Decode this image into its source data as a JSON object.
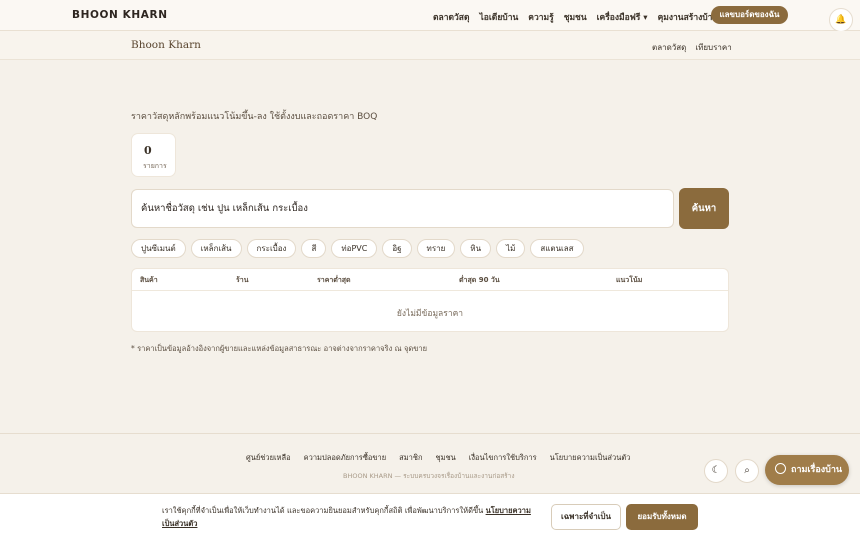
{
  "header": {
    "brand": "BHOON KHARN",
    "nav": [
      "ตลาดวัสดุ",
      "ไอเดียบ้าน",
      "ความรู้",
      "ชุมชน",
      "เครื่องมือฟรี ▾",
      "คุมงานสร้างบ้าน"
    ],
    "cta": "แลขบอร์ดของฉัน",
    "bell_icon": "🔔"
  },
  "subnav": {
    "brand": "Bhoon Kharn",
    "links": [
      "ตลาดวัสดุ",
      "เทียบราคา"
    ]
  },
  "main": {
    "subtitle": "ราคาวัสดุหลักพร้อมแนวโน้มขึ้น-ลง ใช้ตั้งงบและถอดราคา BOQ",
    "stat": {
      "value": "0",
      "label": "รายการ"
    },
    "search": {
      "placeholder": "ค้นหาชื่อวัสดุ เช่น ปูน เหล็กเส้น กระเบื้อง",
      "button": "ค้นหา"
    },
    "chips": [
      "ปูนซีเมนต์",
      "เหล็กเส้น",
      "กระเบื้อง",
      "สี",
      "ท่อPVC",
      "อิฐ",
      "ทราย",
      "หิน",
      "ไม้",
      "สแตนเลส"
    ],
    "table": {
      "headers": [
        "สินค้า",
        "ร้าน",
        "ราคาต่ำสุด",
        "ต่ำสุด 90 วัน",
        "แนวโน้ม"
      ],
      "empty": "ยังไม่มีข้อมูลราคา"
    },
    "note": "* ราคาเป็นข้อมูลอ้างอิงจากผู้ขายและแหล่งข้อมูลสาธารณะ อาจต่างจากราคาจริง ณ จุดขาย"
  },
  "footer": {
    "links": [
      "ศูนย์ช่วยเหลือ",
      "ความปลอดภัยการซื้อขาย",
      "สมาชิก",
      "ชุมชน",
      "เงื่อนไขการใช้บริการ",
      "นโยบายความเป็นส่วนตัว"
    ],
    "copyright": "BHOON KHARN — ระบบครบวงจรเรื่องบ้านและงานก่อสร้าง"
  },
  "floating": {
    "theme_icon": "☾",
    "search_icon": "⌕",
    "chat_label": "ถามเรื่องบ้าน"
  },
  "cookie": {
    "text": "เราใช้คุกกี้ที่จำเป็นเพื่อให้เว็บทำงานได้ และขอความยินยอมสำหรับคุกกี้สถิติ เพื่อพัฒนาบริการให้ดีขึ้น",
    "link": "นโยบายความเป็นส่วนตัว",
    "btn_essential": "เฉพาะที่จำเป็น",
    "btn_accept": "ยอมรับทั้งหมด"
  }
}
